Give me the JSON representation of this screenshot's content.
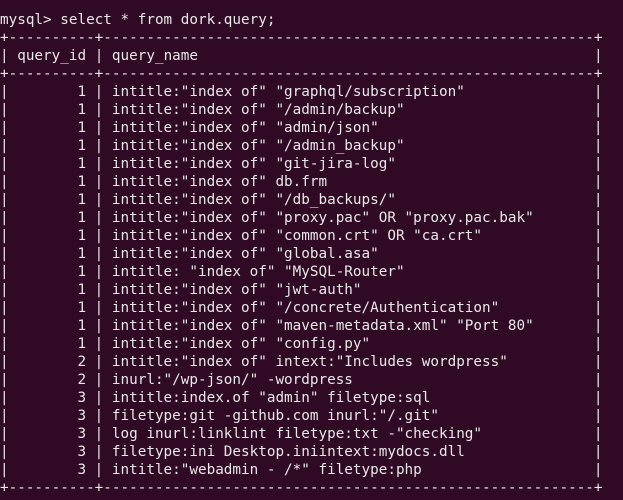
{
  "terminal": {
    "prompt": "mysql> ",
    "command": "select * from dork.query;",
    "border_line": "+----------+---------------------------------------------------------+",
    "header": {
      "col1": "query_id",
      "col2": "query_name"
    },
    "rows": [
      {
        "query_id": "1",
        "query_name": "intitle:\"index of\" \"graphql/subscription\""
      },
      {
        "query_id": "1",
        "query_name": "intitle:\"index of\" \"/admin/backup\""
      },
      {
        "query_id": "1",
        "query_name": "intitle:\"index of\" \"admin/json\""
      },
      {
        "query_id": "1",
        "query_name": "intitle:\"index of\" \"/admin_backup\""
      },
      {
        "query_id": "1",
        "query_name": "intitle:\"index of\" \"git-jira-log\""
      },
      {
        "query_id": "1",
        "query_name": "intitle:\"index of\" db.frm"
      },
      {
        "query_id": "1",
        "query_name": "intitle:\"index of\" \"/db_backups/\""
      },
      {
        "query_id": "1",
        "query_name": "intitle:\"index of\" \"proxy.pac\" OR \"proxy.pac.bak\""
      },
      {
        "query_id": "1",
        "query_name": "intitle:\"index of\" \"common.crt\" OR \"ca.crt\""
      },
      {
        "query_id": "1",
        "query_name": "intitle:\"index of\" \"global.asa\""
      },
      {
        "query_id": "1",
        "query_name": "intitle: \"index of\" \"MySQL-Router\""
      },
      {
        "query_id": "1",
        "query_name": "intitle:\"index of\" \"jwt-auth\""
      },
      {
        "query_id": "1",
        "query_name": "intitle:\"index of\" \"/concrete/Authentication\""
      },
      {
        "query_id": "1",
        "query_name": "intitle:\"index of\" \"maven-metadata.xml\" \"Port 80\""
      },
      {
        "query_id": "1",
        "query_name": "intitle:\"index of\" \"config.py\""
      },
      {
        "query_id": "2",
        "query_name": "intitle:\"index of\" intext:\"Includes wordpress\""
      },
      {
        "query_id": "2",
        "query_name": "inurl:\"/wp-json/\" -wordpress"
      },
      {
        "query_id": "3",
        "query_name": "intitle:index.of \"admin\" filetype:sql"
      },
      {
        "query_id": "3",
        "query_name": "filetype:git -github.com inurl:\"/.git\""
      },
      {
        "query_id": "3",
        "query_name": "log inurl:linklint filetype:txt -\"checking\""
      },
      {
        "query_id": "3",
        "query_name": "filetype:ini Desktop.iniintext:mydocs.dll"
      },
      {
        "query_id": "3",
        "query_name": "intitle:\"webadmin - /*\" filetype:php"
      }
    ]
  },
  "colors": {
    "background": "#300a24",
    "text": "#e8e8e8"
  }
}
